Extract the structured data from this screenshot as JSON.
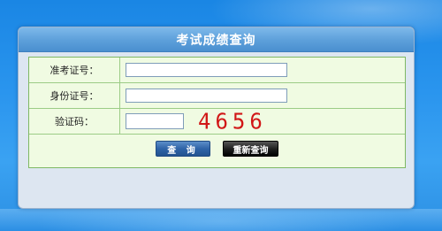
{
  "panel": {
    "title": "考试成绩查询"
  },
  "form": {
    "exam_id": {
      "label": "准考证号：",
      "value": ""
    },
    "id_number": {
      "label": "身份证号：",
      "value": ""
    },
    "captcha": {
      "label": "验证码：",
      "value": "",
      "image_text": "4656",
      "image_color": "#d11717"
    },
    "buttons": {
      "query_label": "查 询",
      "reset_label": "重新查询"
    }
  },
  "colors": {
    "background": "#2a95ee",
    "header": "#5c9fda",
    "form_background": "#f0fbe2",
    "form_border": "#7fb864"
  }
}
